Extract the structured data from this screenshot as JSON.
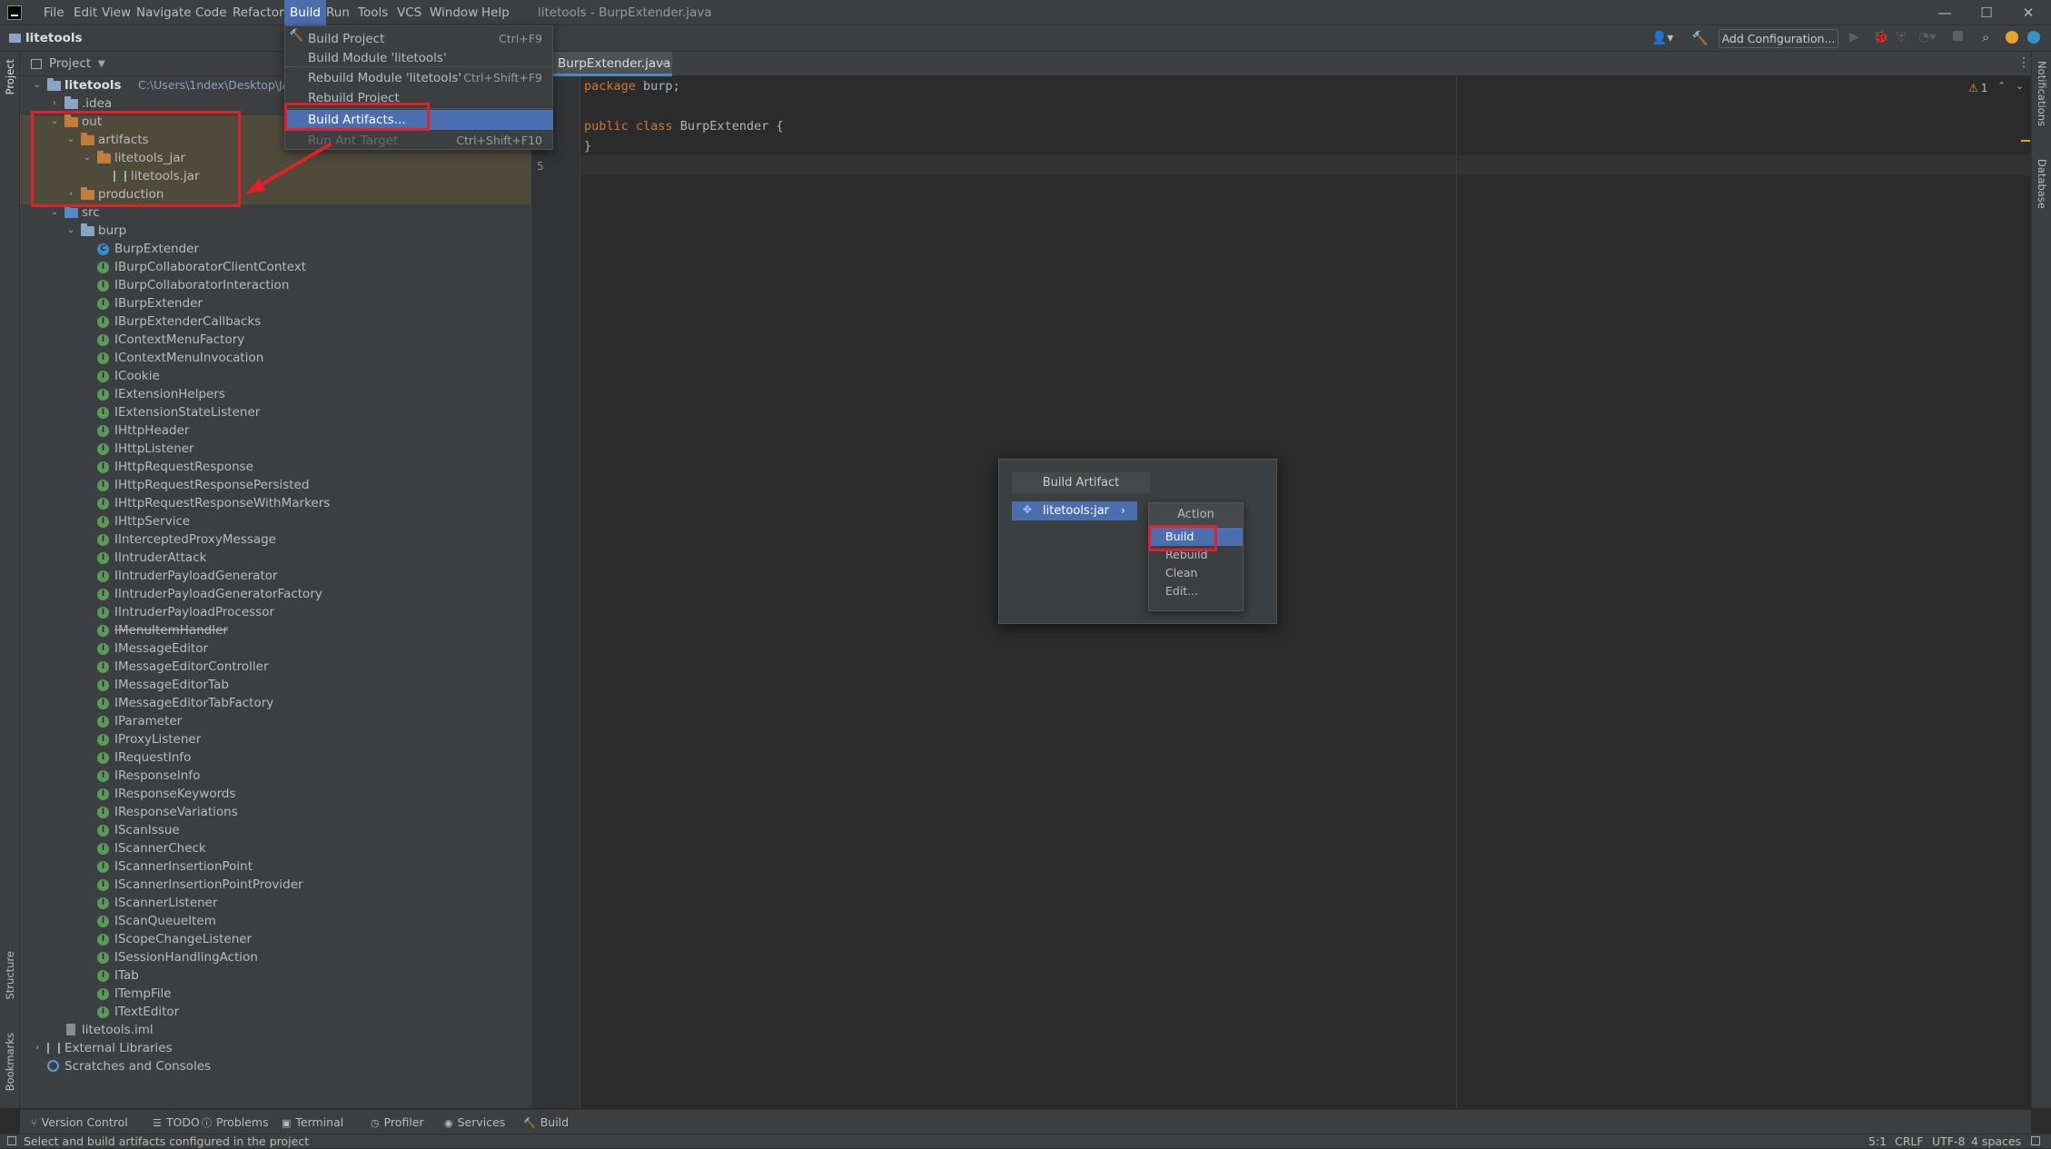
{
  "app": {
    "window_title": "litetools - BurpExtender.java",
    "project_name": "litetools"
  },
  "menubar": {
    "items": [
      "File",
      "Edit",
      "View",
      "Navigate",
      "Code",
      "Refactor",
      "Build",
      "Run",
      "Tools",
      "VCS",
      "Window",
      "Help"
    ],
    "active": "Build"
  },
  "toolbar": {
    "add_configuration": "Add Configuration..."
  },
  "build_menu": {
    "items": [
      {
        "label": "Build Project",
        "shortcut": "Ctrl+F9"
      },
      {
        "label": "Build Module 'litetools'",
        "shortcut": ""
      },
      {
        "label": "Rebuild Module 'litetools'",
        "shortcut": "Ctrl+Shift+F9"
      },
      {
        "label": "Rebuild Project",
        "shortcut": ""
      },
      {
        "label": "Build Artifacts...",
        "shortcut": ""
      },
      {
        "label": "Run Ant Target",
        "shortcut": "Ctrl+Shift+F10"
      }
    ]
  },
  "project_panel": {
    "header": "Project",
    "root_label": "litetools",
    "root_path": "C:\\Users\\1ndex\\Desktop\\JAVA\\B",
    "idea": ".idea",
    "out": "out",
    "artifacts": "artifacts",
    "litetools_jar_dir": "litetools_jar",
    "litetools_jar_file": "litetools.jar",
    "production": "production",
    "src": "src",
    "burp": "burp",
    "classes": [
      "BurpExtender",
      "IBurpCollaboratorClientContext",
      "IBurpCollaboratorInteraction",
      "IBurpExtender",
      "IBurpExtenderCallbacks",
      "IContextMenuFactory",
      "IContextMenuInvocation",
      "ICookie",
      "IExtensionHelpers",
      "IExtensionStateListener",
      "IHttpHeader",
      "IHttpListener",
      "IHttpRequestResponse",
      "IHttpRequestResponsePersisted",
      "IHttpRequestResponseWithMarkers",
      "IHttpService",
      "IInterceptedProxyMessage",
      "IIntruderAttack",
      "IIntruderPayloadGenerator",
      "IIntruderPayloadGeneratorFactory",
      "IIntruderPayloadProcessor",
      "IMenuItemHandler",
      "IMessageEditor",
      "IMessageEditorController",
      "IMessageEditorTab",
      "IMessageEditorTabFactory",
      "IParameter",
      "IProxyListener",
      "IRequestInfo",
      "IResponseInfo",
      "IResponseKeywords",
      "IResponseVariations",
      "IScanIssue",
      "IScannerCheck",
      "IScannerInsertionPoint",
      "IScannerInsertionPointProvider",
      "IScannerListener",
      "IScanQueueItem",
      "IScopeChangeListener",
      "ISessionHandlingAction",
      "ITab",
      "ITempFile",
      "ITextEditor"
    ],
    "iml": "litetools.iml",
    "external_libraries": "External Libraries",
    "scratches": "Scratches and Consoles"
  },
  "editor": {
    "tab": "BurpExtender.java",
    "line_number_visible": "5",
    "warning_count": "1",
    "code": {
      "l1_kw": "package",
      "l1_rest": " burp;",
      "l3_kw1": "public",
      "l3_kw2": " class",
      "l3_name": " BurpExtender",
      "l3_rest": " {",
      "l4": "}"
    }
  },
  "build_artifact_popup": {
    "title": "Build Artifact",
    "artifact": "litetools:jar",
    "action_title": "Action",
    "actions": [
      "Build",
      "Rebuild",
      "Clean",
      "Edit..."
    ]
  },
  "side_labels": {
    "project": "Project",
    "structure": "Structure",
    "bookmarks": "Bookmarks",
    "notifications": "Notifications",
    "database": "Database"
  },
  "tool_windows": [
    "Version Control",
    "TODO",
    "Problems",
    "Terminal",
    "Profiler",
    "Services",
    "Build"
  ],
  "status": {
    "message": "Select and build artifacts configured in the project",
    "position": "5:1",
    "line_sep": "CRLF",
    "encoding": "UTF-8",
    "indent": "4 spaces"
  },
  "colors": {
    "highlight": "#4b6eaf",
    "annotation_red": "#e0202a",
    "interface_icon": "#5a9b5a",
    "class_icon": "#3a8fc9",
    "folder": "#c37d3b"
  }
}
